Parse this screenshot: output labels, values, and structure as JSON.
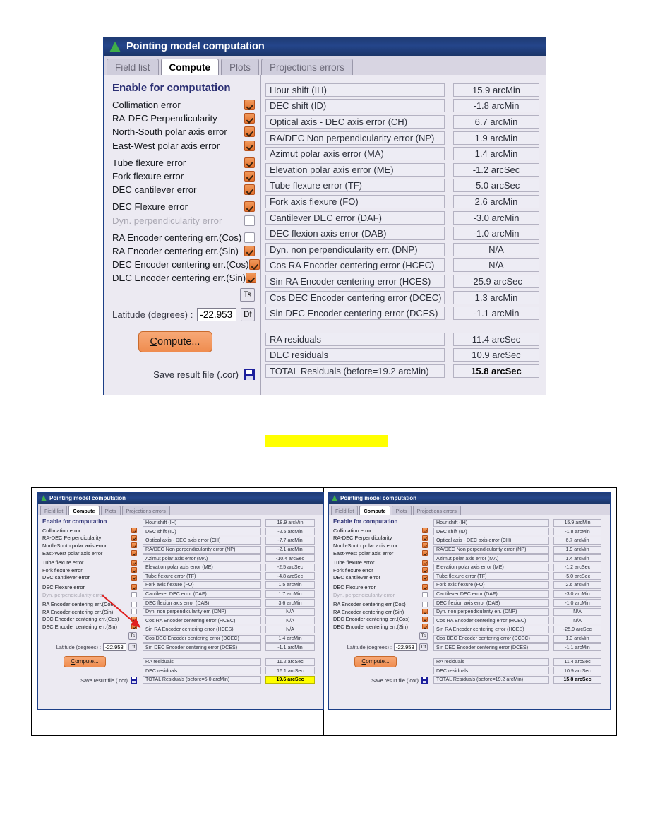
{
  "window": {
    "title": "Pointing model computation",
    "icon": "pyramid-icon",
    "tabs": [
      {
        "label": "Field list",
        "active": false
      },
      {
        "label": "Compute",
        "active": true
      },
      {
        "label": "Plots",
        "active": false
      },
      {
        "label": "Projections errors",
        "active": false
      }
    ]
  },
  "left_panel": {
    "heading": "Enable for computation",
    "checkboxes": [
      {
        "label": "Collimation error",
        "checked": true,
        "dim": false
      },
      {
        "label": "RA-DEC Perpendicularity",
        "checked": true,
        "dim": false
      },
      {
        "label": "North-South polar axis error",
        "checked": true,
        "dim": false
      },
      {
        "label": "East-West polar axis error",
        "checked": true,
        "dim": false
      },
      {
        "label": "Tube flexure error",
        "checked": true,
        "dim": false
      },
      {
        "label": "Fork flexure error",
        "checked": true,
        "dim": false
      },
      {
        "label": "DEC cantilever error",
        "checked": true,
        "dim": false
      },
      {
        "label": "DEC Flexure error",
        "checked": true,
        "dim": false
      },
      {
        "label": "Dyn. perpendicularity error",
        "checked": false,
        "dim": true
      },
      {
        "label": "RA Encoder centering err.(Cos)",
        "checked": false,
        "dim": false
      },
      {
        "label": "RA Encoder centering err.(Sin)",
        "checked": true,
        "dim": false
      },
      {
        "label": "DEC Encoder centering err.(Cos)",
        "checked": true,
        "dim": false
      },
      {
        "label": "DEC Encoder centering err.(Sin)",
        "checked": true,
        "dim": false
      }
    ],
    "ts_button": "Ts",
    "df_button": "Df",
    "latitude_label": "Latitude (degrees) :",
    "latitude_value": "-22.953",
    "compute_button_pre": "C",
    "compute_button_post": "ompute...",
    "save_label": "Save result file (.cor)",
    "save_icon": "floppy-disk-icon"
  },
  "right_panel": {
    "fields": [
      {
        "name": "Hour shift (IH)",
        "value": "15.9 arcMin"
      },
      {
        "name": "DEC shift (ID)",
        "value": "-1.8 arcMin"
      },
      {
        "name": "Optical axis - DEC axis error (CH)",
        "value": "6.7 arcMin"
      },
      {
        "name": "RA/DEC Non perpendicularity error (NP)",
        "value": "1.9 arcMin"
      },
      {
        "name": "Azimut polar axis error (MA)",
        "value": "1.4 arcMin"
      },
      {
        "name": "Elevation polar axis error (ME)",
        "value": "-1.2 arcSec"
      },
      {
        "name": "Tube flexure error (TF)",
        "value": "-5.0 arcSec"
      },
      {
        "name": "Fork axis flexure (FO)",
        "value": "2.6 arcMin"
      },
      {
        "name": "Cantilever DEC error (DAF)",
        "value": "-3.0 arcMin"
      },
      {
        "name": "DEC flexion axis error (DAB)",
        "value": "-1.0 arcMin"
      },
      {
        "name": "Dyn. non perpendicularity err. (DNP)",
        "value": "N/A"
      },
      {
        "name": "Cos RA Encoder centering error (HCEC)",
        "value": "N/A"
      },
      {
        "name": "Sin RA Encoder centering error (HCES)",
        "value": "-25.9 arcSec"
      },
      {
        "name": "Cos DEC Encoder centering error (DCEC)",
        "value": "1.3 arcMin"
      },
      {
        "name": "Sin DEC Encoder centering error (DCES)",
        "value": "-1.1 arcMin"
      }
    ],
    "residuals": [
      {
        "name": "RA residuals",
        "value": "11.4 arcSec",
        "total": false,
        "highlight": false
      },
      {
        "name": "DEC residuals",
        "value": "10.9 arcSec",
        "total": false,
        "highlight": false
      },
      {
        "name": "TOTAL Residuals (before=19.2 arcMin)",
        "value": "15.8 arcSec",
        "total": true,
        "highlight": false
      }
    ]
  },
  "thumbnail_left": {
    "heading": "Enable for computation",
    "checkboxes": [
      {
        "label": "Collimation error",
        "checked": true,
        "dim": false
      },
      {
        "label": "RA-DEC Perpendicularity",
        "checked": true,
        "dim": false
      },
      {
        "label": "North-South polar axis error",
        "checked": true,
        "dim": false
      },
      {
        "label": "East-West polar axis error",
        "checked": true,
        "dim": false
      },
      {
        "label": "Tube flexure error",
        "checked": true,
        "dim": false
      },
      {
        "label": "Fork flexure error",
        "checked": true,
        "dim": false
      },
      {
        "label": "DEC cantilever error",
        "checked": true,
        "dim": false
      },
      {
        "label": "DEC Flexure error",
        "checked": true,
        "dim": false
      },
      {
        "label": "Dyn. perpendicularity error",
        "checked": false,
        "dim": true
      },
      {
        "label": "RA Encoder centering err.(Cos)",
        "checked": false,
        "dim": false
      },
      {
        "label": "RA Encoder centering err.(Sin)",
        "checked": false,
        "dim": false
      },
      {
        "label": "DEC Encoder centering err.(Cos)",
        "checked": true,
        "dim": false
      },
      {
        "label": "DEC Encoder centering err.(Sin)",
        "checked": true,
        "dim": false
      }
    ],
    "ts_button": "Ts",
    "df_button": "Df",
    "latitude_label": "Latitude (degrees) :",
    "latitude_value": "-22.953",
    "compute_button_pre": "C",
    "compute_button_post": "ompute...",
    "save_label": "Save result file (.cor)",
    "fields": [
      {
        "name": "Hour shift (IH)",
        "value": "18.9 arcMin"
      },
      {
        "name": "DEC shift (ID)",
        "value": "-2.5 arcMin"
      },
      {
        "name": "Optical axis - DEC axis error (CH)",
        "value": "-7.7 arcMin"
      },
      {
        "name": "RA/DEC Non perpendicularity error (NP)",
        "value": "-2.1 arcMin"
      },
      {
        "name": "Azimut polar axis error (MA)",
        "value": "-10.4 arcSec"
      },
      {
        "name": "Elevation polar axis error (ME)",
        "value": "-2.5 arcSec"
      },
      {
        "name": "Tube flexure error (TF)",
        "value": "-4.8 arcSec"
      },
      {
        "name": "Fork axis flexure (FO)",
        "value": "1.5 arcMin"
      },
      {
        "name": "Cantilever DEC error (DAF)",
        "value": "1.7 arcMin"
      },
      {
        "name": "DEC flexion axis error (DAB)",
        "value": "3.6 arcMin"
      },
      {
        "name": "Dyn. non perpendicularity err. (DNP)",
        "value": "N/A"
      },
      {
        "name": "Cos RA Encoder centering error (HCEC)",
        "value": "N/A"
      },
      {
        "name": "Sin RA Encoder centering error (HCES)",
        "value": "N/A"
      },
      {
        "name": "Cos DEC Encoder centering error (DCEC)",
        "value": "1.4 arcMin"
      },
      {
        "name": "Sin DEC Encoder centering error (DCES)",
        "value": "-1.1 arcMin"
      }
    ],
    "residuals": [
      {
        "name": "RA residuals",
        "value": "11.2 arcSec",
        "total": false,
        "highlight": false
      },
      {
        "name": "DEC residuals",
        "value": "16.1 arcSec",
        "total": false,
        "highlight": false
      },
      {
        "name": "TOTAL Residuals (before=5.0 arcMin)",
        "value": "19.6 arcSec",
        "total": true,
        "highlight": true
      }
    ],
    "annotation": {
      "type": "red-arrow",
      "color": "#e02020"
    }
  },
  "thumbnail_right": {
    "heading": "Enable for computation",
    "checkboxes": [
      {
        "label": "Collimation error",
        "checked": true,
        "dim": false
      },
      {
        "label": "RA-DEC Perpendicularity",
        "checked": true,
        "dim": false
      },
      {
        "label": "North-South polar axis error",
        "checked": true,
        "dim": false
      },
      {
        "label": "East-West polar axis error",
        "checked": true,
        "dim": false
      },
      {
        "label": "Tube flexure error",
        "checked": true,
        "dim": false
      },
      {
        "label": "Fork flexure error",
        "checked": true,
        "dim": false
      },
      {
        "label": "DEC cantilever error",
        "checked": true,
        "dim": false
      },
      {
        "label": "DEC Flexure error",
        "checked": true,
        "dim": false
      },
      {
        "label": "Dyn. perpendicularity error",
        "checked": false,
        "dim": true
      },
      {
        "label": "RA Encoder centering err.(Cos)",
        "checked": false,
        "dim": false
      },
      {
        "label": "RA Encoder centering err.(Sin)",
        "checked": true,
        "dim": false
      },
      {
        "label": "DEC Encoder centering err.(Cos)",
        "checked": true,
        "dim": false
      },
      {
        "label": "DEC Encoder centering err.(Sin)",
        "checked": true,
        "dim": false
      }
    ],
    "ts_button": "Ts",
    "df_button": "Df",
    "latitude_label": "Latitude (degrees) :",
    "latitude_value": "-22.953",
    "compute_button_pre": "C",
    "compute_button_post": "ompute...",
    "save_label": "Save result file (.cor)",
    "fields": [
      {
        "name": "Hour shift (IH)",
        "value": "15.9 arcMin"
      },
      {
        "name": "DEC shift (ID)",
        "value": "-1.8 arcMin"
      },
      {
        "name": "Optical axis - DEC axis error (CH)",
        "value": "6.7 arcMin"
      },
      {
        "name": "RA/DEC Non perpendicularity error (NP)",
        "value": "1.9 arcMin"
      },
      {
        "name": "Azimut polar axis error (MA)",
        "value": "1.4 arcMin"
      },
      {
        "name": "Elevation polar axis error (ME)",
        "value": "-1.2 arcSec"
      },
      {
        "name": "Tube flexure error (TF)",
        "value": "-5.0 arcSec"
      },
      {
        "name": "Fork axis flexure (FO)",
        "value": "2.6 arcMin"
      },
      {
        "name": "Cantilever DEC error (DAF)",
        "value": "-3.0 arcMin"
      },
      {
        "name": "DEC flexion axis error (DAB)",
        "value": "-1.0 arcMin"
      },
      {
        "name": "Dyn. non perpendicularity err. (DNP)",
        "value": "N/A"
      },
      {
        "name": "Cos RA Encoder centering error (HCEC)",
        "value": "N/A"
      },
      {
        "name": "Sin RA Encoder centering error (HCES)",
        "value": "-25.9 arcSec"
      },
      {
        "name": "Cos DEC Encoder centering error (DCEC)",
        "value": "1.3 arcMin"
      },
      {
        "name": "Sin DEC Encoder centering error (DCES)",
        "value": "-1.1 arcMin"
      }
    ],
    "residuals": [
      {
        "name": "RA residuals",
        "value": "11.4 arcSec",
        "total": false,
        "highlight": false
      },
      {
        "name": "DEC residuals",
        "value": "10.9 arcSec",
        "total": false,
        "highlight": false
      },
      {
        "name": "TOTAL Residuals (before=19.2 arcMin)",
        "value": "15.8 arcSec",
        "total": true,
        "highlight": false
      }
    ]
  },
  "redaction_bar": {
    "color": "#ffff00"
  }
}
